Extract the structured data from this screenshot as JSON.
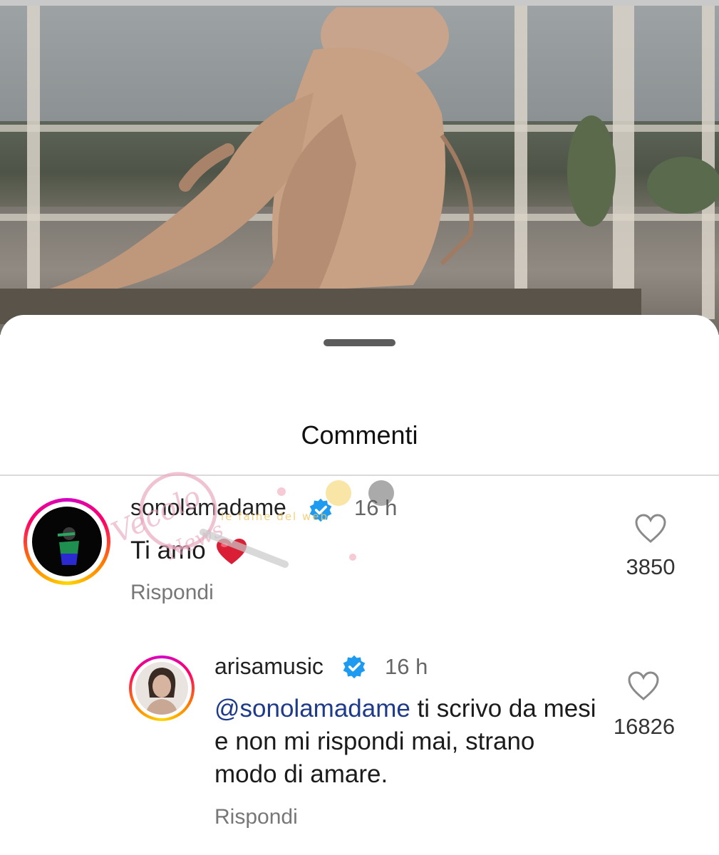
{
  "sheet": {
    "title": "Commenti"
  },
  "comments": [
    {
      "username": "sonolamadame",
      "verified": true,
      "time": "16 h",
      "text": "Ti amo",
      "emoji": "heart",
      "reply_label": "Rispondi",
      "likes": "3850",
      "avatar_icon": "avatar-photo"
    },
    {
      "username": "arisamusic",
      "verified": true,
      "time": "16 h",
      "mention": "@sonolamadame",
      "text": " ti scrivo da mesi e non mi rispondi mai, strano modo di amare.",
      "reply_label": "Rispondi",
      "likes": "16826",
      "avatar_icon": "avatar-photo"
    }
  ],
  "colors": {
    "verified_blue": "#1d9bf0",
    "mention_blue": "#1e3a8a",
    "heart_red": "#d91e36"
  },
  "watermark": {
    "text": "Vecolo delle News",
    "subtext": "le faine del web"
  }
}
